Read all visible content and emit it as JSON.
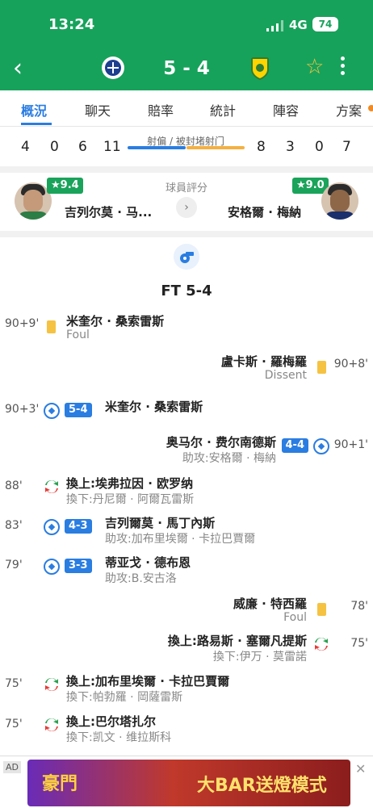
{
  "status": {
    "time": "13:24",
    "network": "4G",
    "battery": "74"
  },
  "header": {
    "score": "5 - 4"
  },
  "tabs": [
    "概況",
    "聊天",
    "賠率",
    "統計",
    "陣容",
    "方案"
  ],
  "stats": {
    "label": "射偏 / 被封堵射门",
    "left": [
      "4",
      "0",
      "6",
      "11"
    ],
    "right": [
      "8",
      "3",
      "0",
      "7"
    ]
  },
  "ratings": {
    "title": "球員評分",
    "left": {
      "score": "★9.4",
      "name": "吉列尔莫 · 马..."
    },
    "right": {
      "score": "★9.0",
      "name": "安格爾 · 梅納"
    }
  },
  "ft": "FT 5-4",
  "events": [
    {
      "side": "l",
      "kind": "yellow",
      "minute": "90+9'",
      "main": "米奎尔 · 桑索雷斯",
      "sub": "Foul"
    },
    {
      "side": "r",
      "kind": "yellow",
      "minute": "90+8'",
      "main": "盧卡斯 · 羅梅羅",
      "sub": "Dissent"
    },
    {
      "side": "l",
      "kind": "goal",
      "minute": "90+3'",
      "score": "5-4",
      "main": "米奎尔 · 桑索雷斯",
      "sub": ""
    },
    {
      "side": "r",
      "kind": "goal",
      "minute": "90+1'",
      "score": "4-4",
      "main": "奥马尔 · 费尔南德斯",
      "sub": "助攻:安格爾 · 梅納"
    },
    {
      "side": "l",
      "kind": "sub",
      "minute": "88'",
      "main": "換上:埃弗拉因 · 欧罗纳",
      "sub": "換下:丹尼爾 · 阿爾瓦雷斯"
    },
    {
      "side": "l",
      "kind": "goal",
      "minute": "83'",
      "score": "4-3",
      "main": "吉列爾莫 · 馬丁內斯",
      "sub": "助攻:加布里埃爾 · 卡拉巴賈爾"
    },
    {
      "side": "l",
      "kind": "goal",
      "minute": "79'",
      "score": "3-3",
      "main": "蒂亚戈 · 德布恩",
      "sub": "助攻:B.安古洛"
    },
    {
      "side": "r",
      "kind": "yellow",
      "minute": "78'",
      "main": "威廉 · 特西羅",
      "sub": "Foul"
    },
    {
      "side": "r",
      "kind": "sub",
      "minute": "75'",
      "main": "換上:路易斯 · 塞爾凡提斯",
      "sub": "換下:伊万 · 莫雷諾"
    },
    {
      "side": "l",
      "kind": "sub",
      "minute": "75'",
      "main": "換上:加布里埃爾 · 卡拉巴賈爾",
      "sub": "換下:帕勃羅 · 岡薩雷斯"
    },
    {
      "side": "l",
      "kind": "sub",
      "minute": "75'",
      "main": "換上:巴尔塔扎尔",
      "sub": "換下:凯文 · 维拉斯科"
    }
  ],
  "ad": {
    "tag": "AD",
    "left_text": "豪門",
    "right_text": "大BAR送燈模式"
  },
  "colors": {
    "brand_green": "#17a25b",
    "accent_blue": "#2a7de1",
    "yellow_card": "#f5c242"
  }
}
